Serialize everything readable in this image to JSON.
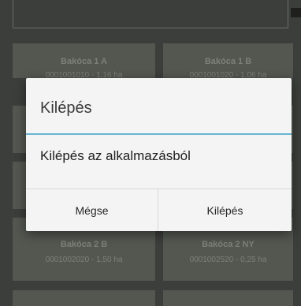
{
  "cards": [
    {
      "name": "Bakóca 1 A",
      "meta": "0001001010 - 1,16 ha"
    },
    {
      "name": "Bakóca 1 B",
      "meta": "0001001020 - 1,06 ha"
    },
    {
      "name": "Bakóca 2 B",
      "meta": "0001002020 - 1,50 ha"
    },
    {
      "name": "Bakóca 2 NY",
      "meta": "0001002520 - 0,25 ha"
    }
  ],
  "dialog": {
    "title": "Kilépés",
    "message": "Kilépés az alkalmazásból",
    "cancel_label": "Mégse",
    "confirm_label": "Kilépés"
  },
  "colors": {
    "background": "#3c3e3b",
    "card": "#535750",
    "accent_divider": "#6ab5d1",
    "dialog_bg": "#f4f4f4"
  }
}
